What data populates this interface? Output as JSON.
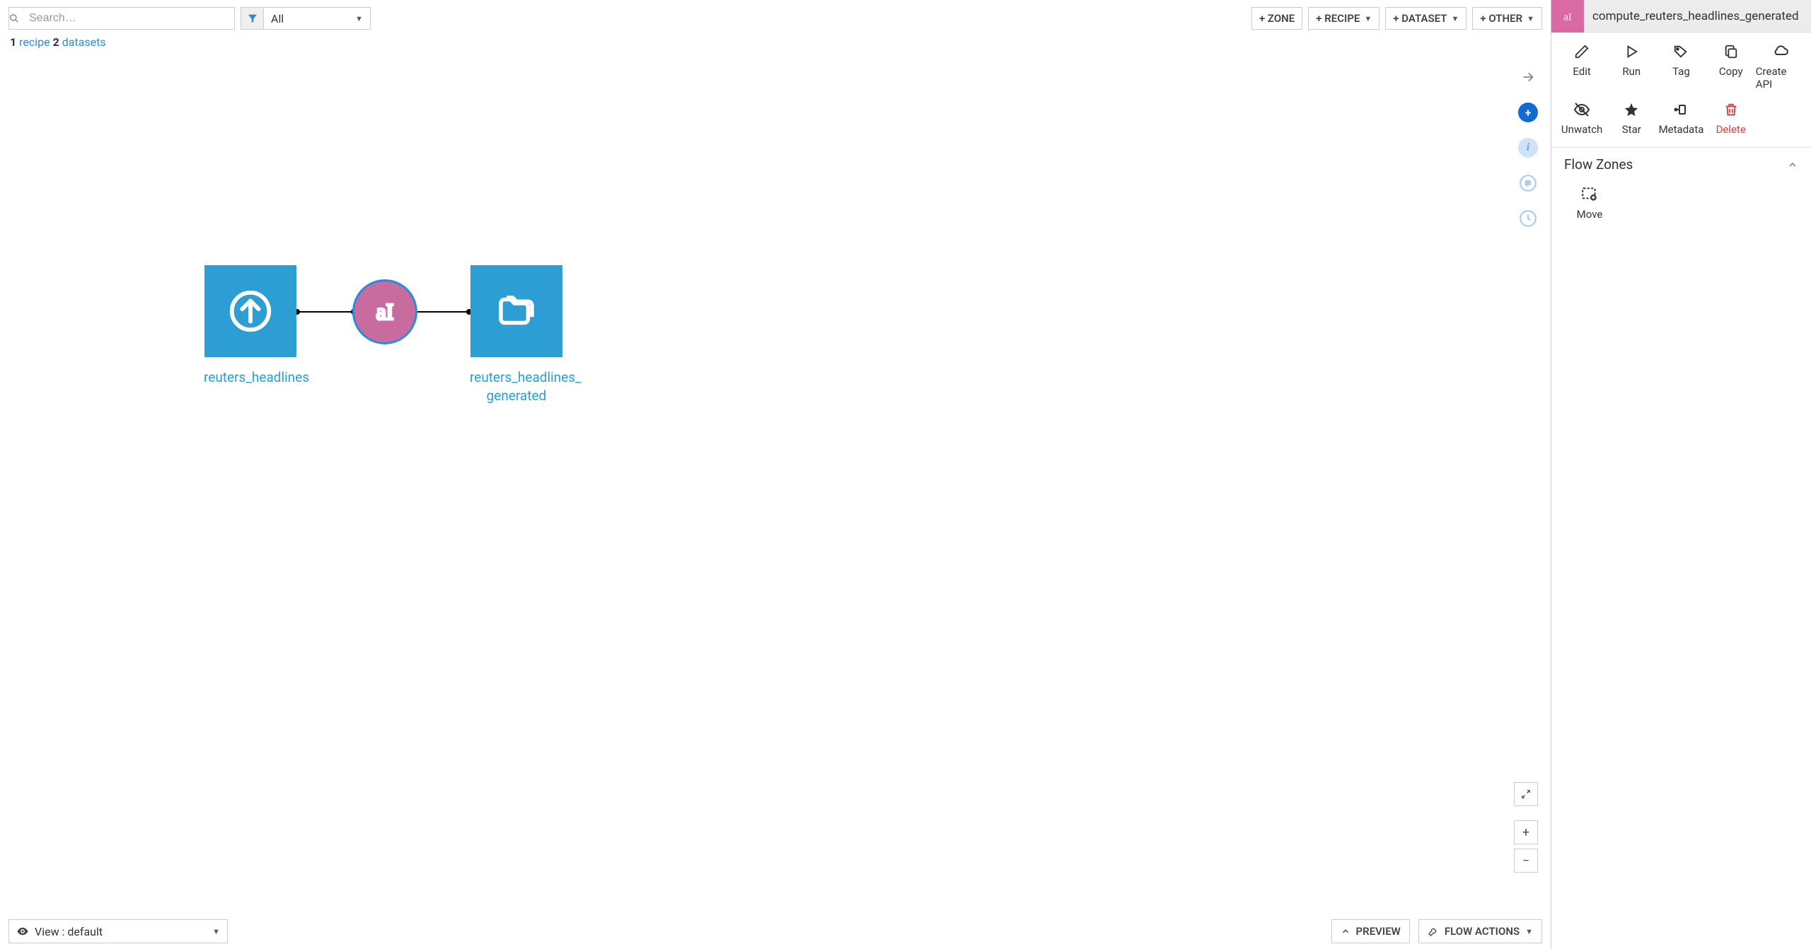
{
  "search": {
    "placeholder": "Search…"
  },
  "filter": {
    "label": "All"
  },
  "toolbar": {
    "zone": "+ ZONE",
    "recipe": "+ RECIPE",
    "dataset": "+ DATASET",
    "other": "+ OTHER"
  },
  "summary": {
    "recipe_count": "1",
    "recipe_word": "recipe",
    "dataset_count": "2",
    "dataset_word": "datasets"
  },
  "nodes": {
    "input": {
      "label": "reuters_headlines"
    },
    "output": {
      "label": "reuters_headlines_\ngenerated"
    }
  },
  "bottom": {
    "view_label": "View : default",
    "preview": "PREVIEW",
    "flow_actions": "FLOW ACTIONS"
  },
  "panel": {
    "title": "compute_reuters_headlines_generated",
    "actions": {
      "edit": "Edit",
      "run": "Run",
      "tag": "Tag",
      "copy": "Copy",
      "create_api": "Create API",
      "unwatch": "Unwatch",
      "star": "Star",
      "metadata": "Metadata",
      "delete": "Delete"
    },
    "zones": {
      "title": "Flow Zones",
      "move": "Move"
    }
  }
}
